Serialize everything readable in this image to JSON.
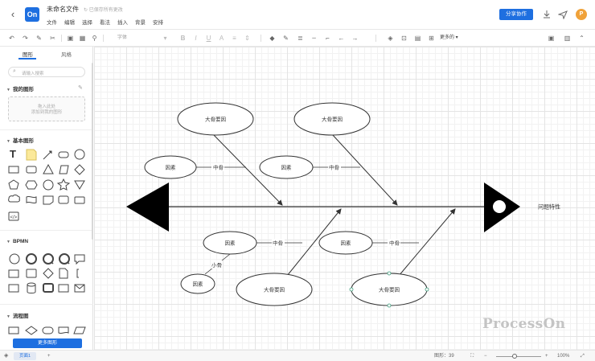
{
  "header": {
    "back_icon": "back-arrow-icon",
    "logo_text": "On",
    "doc_title": "未命名文件",
    "save_status": "已保存所有更改",
    "menus": [
      "文件",
      "编辑",
      "选择",
      "看法",
      "插入",
      "背景",
      "安排"
    ],
    "share_label": "分享协作",
    "avatar_text": "P"
  },
  "toolbar": {
    "font_placeholder": "字体",
    "more_label": "更多的"
  },
  "left_panel": {
    "tabs": [
      "图形",
      "风格"
    ],
    "search_placeholder": "请输入搜索",
    "my_shapes_title": "我的图形",
    "my_shapes_hint_1": "拖入此处",
    "my_shapes_hint_2": "添加到我的图形",
    "basic_title": "基本图形",
    "bpmn_title": "BPMN",
    "flowchart_title": "流程图",
    "more_shapes_label": "更多图形"
  },
  "diagram": {
    "big_causes": [
      "大骨要因",
      "大骨要因",
      "大骨要因",
      "大骨要因"
    ],
    "factors": [
      "因素",
      "因素",
      "因素",
      "因素",
      "因素"
    ],
    "mid_bone_labels": [
      "中骨",
      "中骨",
      "中骨",
      "中骨"
    ],
    "small_bone_label": "小骨",
    "problem_label": "问题特性"
  },
  "watermark": "ProcessOn",
  "footer": {
    "page_tab": "页面1",
    "add_page": "+",
    "shape_count": "图形：39",
    "zoom_minus": "−",
    "zoom_plus": "+",
    "zoom_level": "100%"
  },
  "colors": {
    "brand": "#1e6fe0",
    "avatar": "#f0a23a"
  }
}
